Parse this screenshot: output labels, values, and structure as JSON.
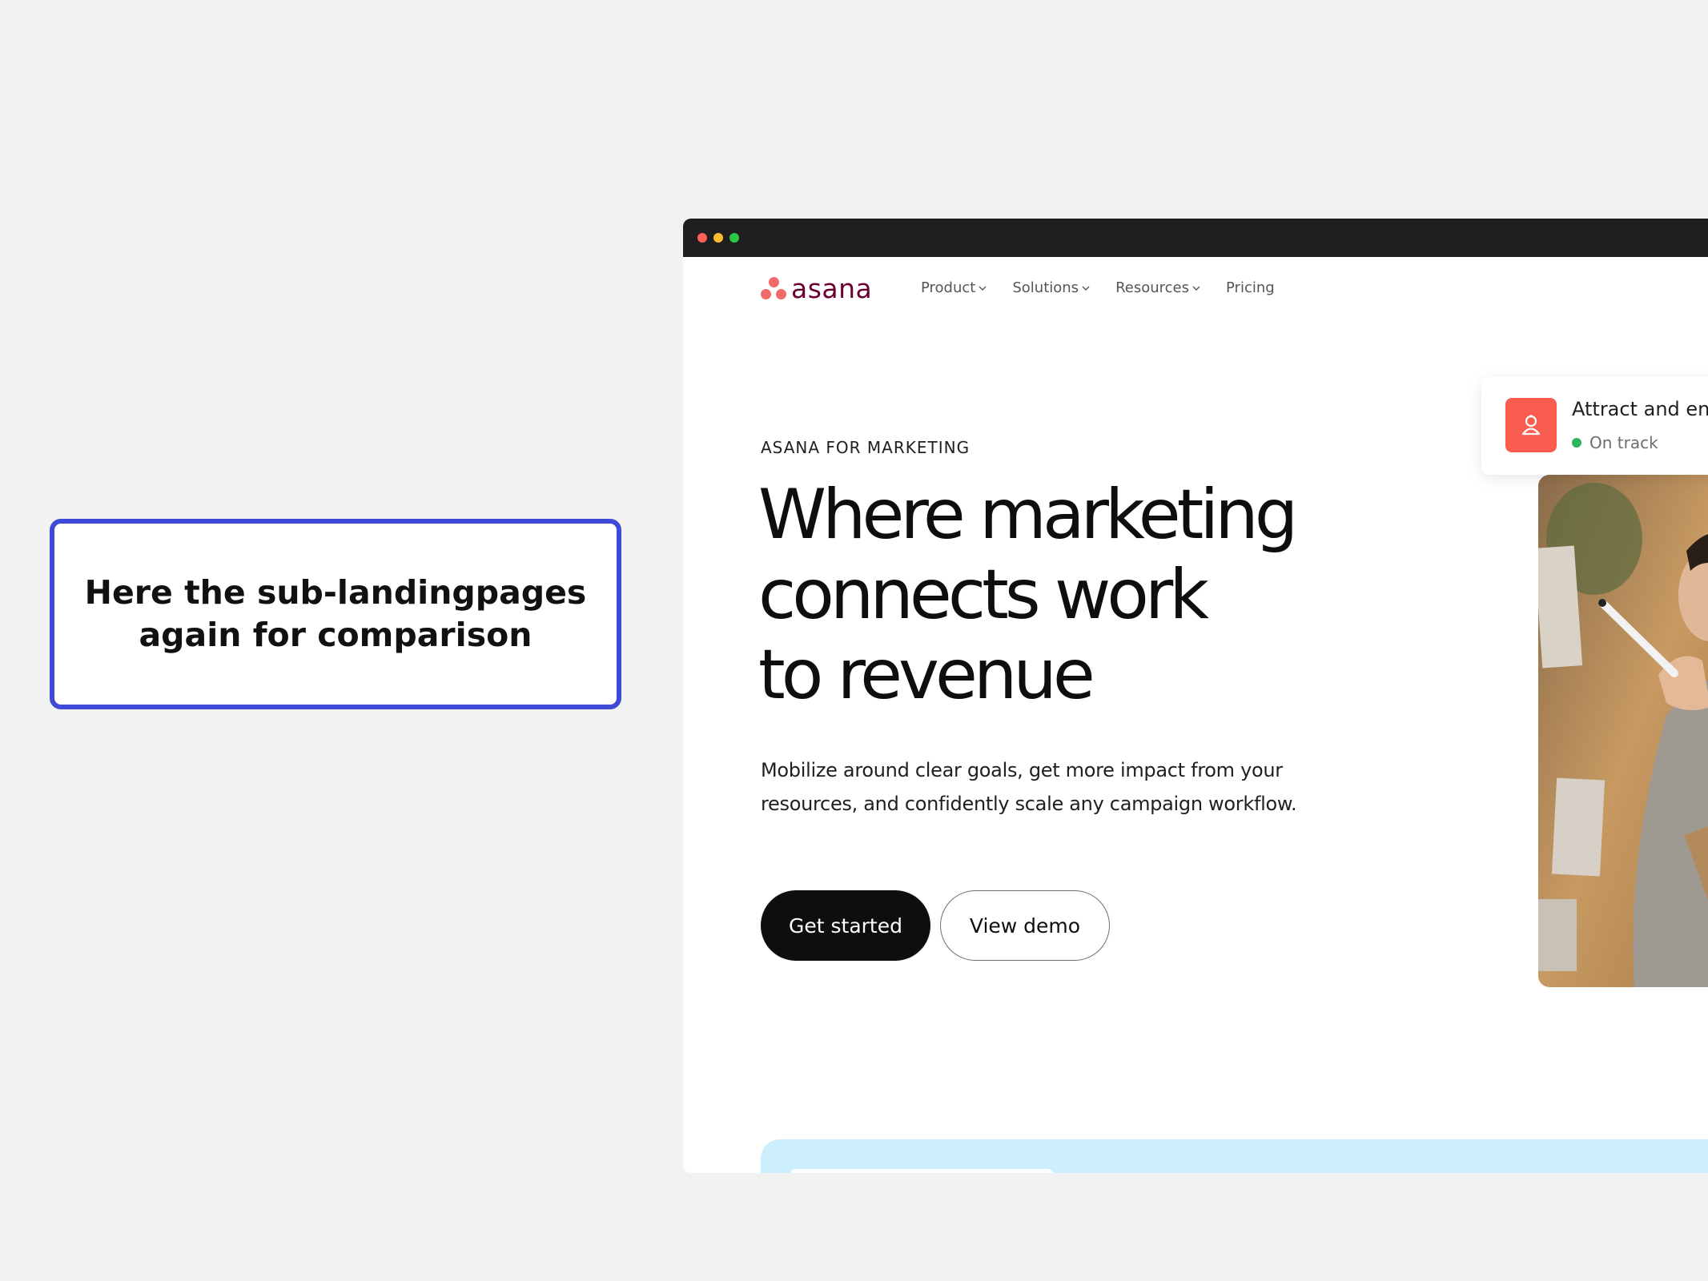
{
  "callout": {
    "text": "Here the sub-landingpages again for comparison"
  },
  "browser": {
    "brand": {
      "name": "asana",
      "logo_color": "#f06a6a",
      "wordmark_color": "#690031"
    },
    "nav": {
      "items": [
        {
          "label": "Product",
          "icon": "chevron-down-icon"
        },
        {
          "label": "Solutions",
          "icon": "chevron-down-icon"
        },
        {
          "label": "Resources",
          "icon": "chevron-down-icon"
        },
        {
          "label": "Pricing"
        }
      ]
    },
    "hero": {
      "eyebrow": "ASANA FOR MARKETING",
      "headline_lines": [
        "Where marketing",
        "connects work",
        "to revenue"
      ],
      "subcopy": "Mobilize around clear goals, get more impact from your resources, and confidently scale any campaign workflow.",
      "primary_button": "Get started",
      "secondary_button": "View demo"
    },
    "goal_card": {
      "title": "Attract and eng",
      "status": "On track",
      "icon": "goal-person-icon",
      "icon_color": "#f95d4f",
      "status_color": "#2bb55e"
    }
  }
}
